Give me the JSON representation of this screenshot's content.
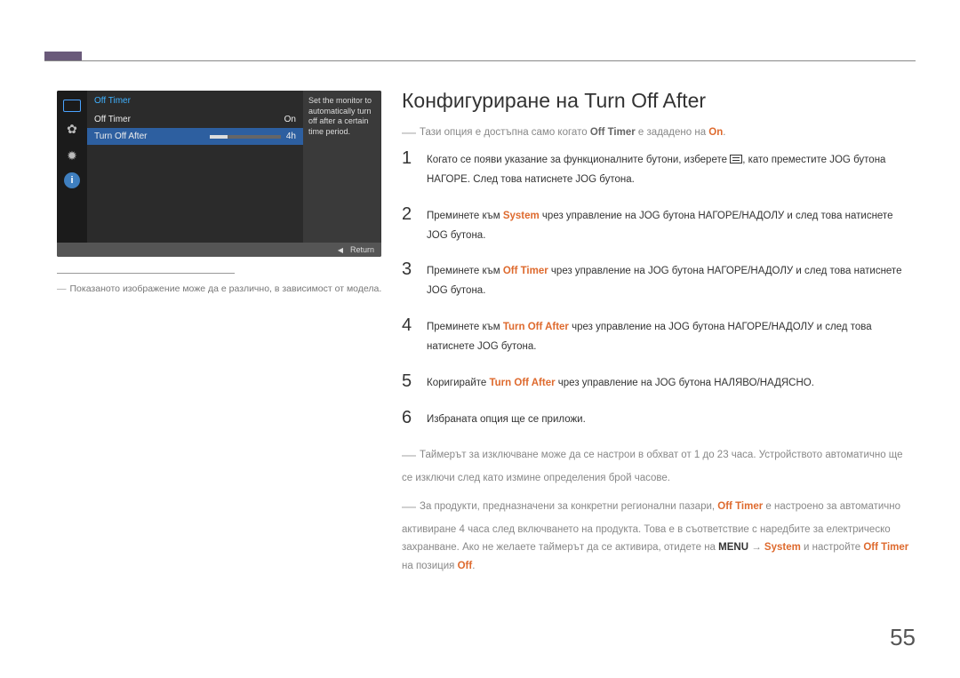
{
  "page_number": "55",
  "osd": {
    "title": "Off Timer",
    "row1_label": "Off Timer",
    "row1_value": "On",
    "row2_label": "Turn Off After",
    "row2_value": "4h",
    "desc": "Set the monitor to automatically turn off after a certain time period.",
    "footer": "Return"
  },
  "left_note": "Показаното изображение може да е различно, в зависимост от модела.",
  "heading": "Конфигуриране на Turn Off After",
  "pre_note": {
    "t1": "Тази опция е достъпна само когато ",
    "b1": "Off Timer",
    "t2": " е зададено на ",
    "b2": "On",
    "t3": "."
  },
  "steps": {
    "1a": "Когато се появи указание за функционалните бутони, изберете ",
    "1b": ", като преместите JOG бутона НАГОРЕ. След това натиснете JOG бутона.",
    "2a": "Преминете към ",
    "2s": "System",
    "2b": " чрез управление на JOG бутона НАГОРЕ/НАДОЛУ и след това натиснете JOG бутона.",
    "3a": "Преминете към ",
    "3s": "Off Timer",
    "3b": " чрез управление на JOG бутона НАГОРЕ/НАДОЛУ и след това натиснете JOG бутона.",
    "4a": "Преминете към ",
    "4s": "Turn Off After",
    "4b": " чрез управление на JOG бутона НАГОРЕ/НАДОЛУ и след това натиснете JOG бутона.",
    "5a": "Коригирайте ",
    "5s": "Turn Off After",
    "5b": " чрез управление на JOG бутона НАЛЯВО/НАДЯСНО.",
    "6": "Избраната опция ще се приложи."
  },
  "endnotes": {
    "n1": "Таймерът за изключване може да се настрои в обхват от 1 до 23 часа. Устройството автоматично ще се изключи след като измине определения брой часове.",
    "n2a": "За продукти, предназначени за конкретни регионални пазари, ",
    "n2s1": "Off Timer",
    "n2b": " е настроено за автоматично активиране 4 часа след включването на продукта. Това е в съответствие с наредбите за електрическо захранване. Ако не желаете таймерът да се активира, отидете на ",
    "n2m": "MENU",
    "n2arr": " → ",
    "n2s2": "System",
    "n2c": " и настройте ",
    "n2s3": "Off Timer",
    "n2d": " на позиция ",
    "n2s4": "Off",
    "n2e": "."
  }
}
